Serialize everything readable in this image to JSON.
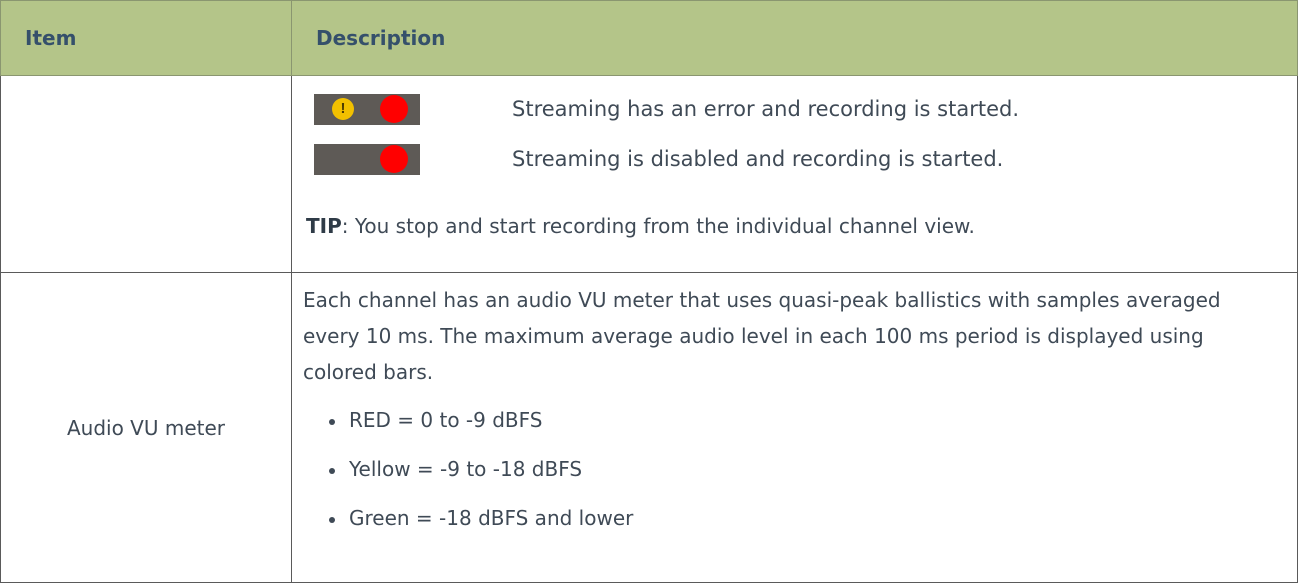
{
  "header": {
    "item_label": "Item",
    "description_label": "Description"
  },
  "rows": [
    {
      "item": "",
      "statuses": [
        {
          "icons": [
            "warning-icon",
            "recording-dot-icon"
          ],
          "text": "Streaming has an error and recording is started."
        },
        {
          "icons": [
            "recording-dot-icon"
          ],
          "text": "Streaming is disabled and recording is started."
        }
      ],
      "tip_label": "TIP",
      "tip_text": ": You stop and start recording from the individual channel view."
    },
    {
      "item": "Audio VU meter",
      "description": "Each channel has an audio VU meter that uses quasi-peak ballistics with samples averaged every 10 ms. The maximum average audio level in each 100 ms period is displayed using colored bars.",
      "levels": [
        "RED = 0 to -9 dBFS",
        "Yellow = -9 to -18 dBFS",
        "Green = -18 dBFS and lower"
      ]
    }
  ],
  "colors": {
    "header_bg": "#b4c589",
    "header_text": "#35506b",
    "body_text": "#3f4a56",
    "status_bar_bg": "#5e5a56",
    "recording_dot": "#ff0000",
    "warning_dot": "#f2c000"
  }
}
